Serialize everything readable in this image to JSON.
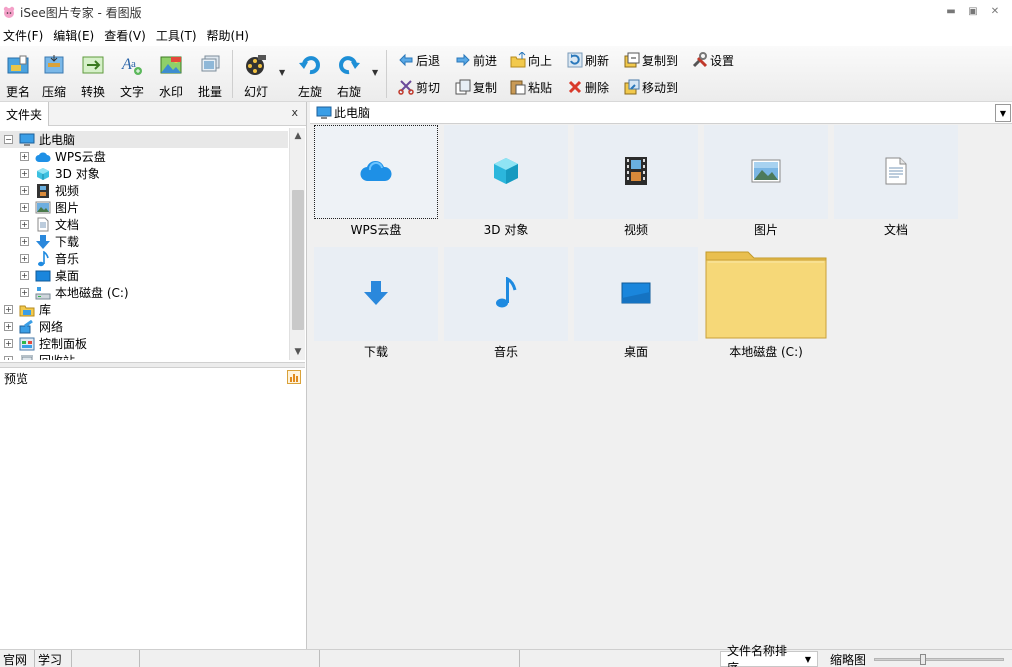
{
  "window": {
    "title": "iSee图片专家 - 看图版"
  },
  "menu": [
    "文件(F)",
    "编辑(E)",
    "查看(V)",
    "工具(T)",
    "帮助(H)"
  ],
  "toolbar": {
    "big_buttons": [
      {
        "label": "更名",
        "icon": "rename-icon"
      },
      {
        "label": "压缩",
        "icon": "compress-icon"
      },
      {
        "label": "转换",
        "icon": "convert-icon"
      },
      {
        "label": "文字",
        "icon": "text-icon"
      },
      {
        "label": "水印",
        "icon": "watermark-icon"
      },
      {
        "label": "批量",
        "icon": "batch-icon"
      },
      {
        "label": "幻灯",
        "icon": "slideshow-icon"
      },
      {
        "label": "左旋",
        "icon": "rotate-left-icon"
      },
      {
        "label": "右旋",
        "icon": "rotate-right-icon"
      }
    ],
    "small_buttons": [
      {
        "label": "后退",
        "icon": "back-arrow-icon"
      },
      {
        "label": "前进",
        "icon": "forward-arrow-icon"
      },
      {
        "label": "向上",
        "icon": "up-folder-icon"
      },
      {
        "label": "刷新",
        "icon": "refresh-icon"
      },
      {
        "label": "复制到",
        "icon": "copy-to-icon"
      },
      {
        "label": "设置",
        "icon": "settings-tools-icon"
      },
      {
        "label": "剪切",
        "icon": "scissors-icon"
      },
      {
        "label": "复制",
        "icon": "copy-icon"
      },
      {
        "label": "粘贴",
        "icon": "paste-icon"
      },
      {
        "label": "删除",
        "icon": "delete-x-icon"
      },
      {
        "label": "移动到",
        "icon": "move-to-icon"
      }
    ]
  },
  "left_panel": {
    "tab_label": "文件夹",
    "close_label": "x",
    "tree": [
      {
        "label": "此电脑",
        "expander": "-",
        "icon": "computer-icon",
        "level": 0,
        "selected": true
      },
      {
        "label": "WPS云盘",
        "expander": "+",
        "icon": "cloud-icon",
        "level": 1
      },
      {
        "label": "3D 对象",
        "expander": "+",
        "icon": "3d-object-icon",
        "level": 1
      },
      {
        "label": "视频",
        "expander": "+",
        "icon": "video-icon",
        "level": 1
      },
      {
        "label": "图片",
        "expander": "+",
        "icon": "picture-icon",
        "level": 1
      },
      {
        "label": "文档",
        "expander": "+",
        "icon": "document-icon",
        "level": 1
      },
      {
        "label": "下载",
        "expander": "+",
        "icon": "download-icon",
        "level": 1
      },
      {
        "label": "音乐",
        "expander": "+",
        "icon": "music-icon",
        "level": 1
      },
      {
        "label": "桌面",
        "expander": "+",
        "icon": "desktop-icon",
        "level": 1
      },
      {
        "label": "本地磁盘 (C:)",
        "expander": "+",
        "icon": "disk-icon",
        "level": 1
      },
      {
        "label": "库",
        "expander": "+",
        "icon": "library-icon",
        "level": 0
      },
      {
        "label": "网络",
        "expander": "+",
        "icon": "network-icon",
        "level": 0
      },
      {
        "label": "控制面板",
        "expander": "+",
        "icon": "control-panel-icon",
        "level": 0
      },
      {
        "label": "回收站",
        "expander": "+",
        "icon": "recycle-bin-icon",
        "level": 0
      }
    ],
    "preview_label": "预览"
  },
  "main": {
    "address": "此电脑",
    "items": [
      {
        "label": "WPS云盘",
        "icon": "cloud-icon",
        "focused": true
      },
      {
        "label": "3D 对象",
        "icon": "3d-object-icon"
      },
      {
        "label": "视频",
        "icon": "video-icon"
      },
      {
        "label": "图片",
        "icon": "picture-icon"
      },
      {
        "label": "文档",
        "icon": "document-icon"
      },
      {
        "label": "下载",
        "icon": "download-icon"
      },
      {
        "label": "音乐",
        "icon": "music-icon"
      },
      {
        "label": "桌面",
        "icon": "desktop-icon"
      },
      {
        "label": "本地磁盘 (C:)",
        "icon": "folder-icon"
      }
    ]
  },
  "statusbar": {
    "official_site": "官网",
    "learn": "学习",
    "sort_label": "文件名称排序",
    "thumb_label": "缩略图",
    "zoom_level": 0.38
  },
  "colors": {
    "accent_blue": "#1e7fd6",
    "thumb_bg": "#e9eef4",
    "folder_yellow": "#f6d878"
  }
}
